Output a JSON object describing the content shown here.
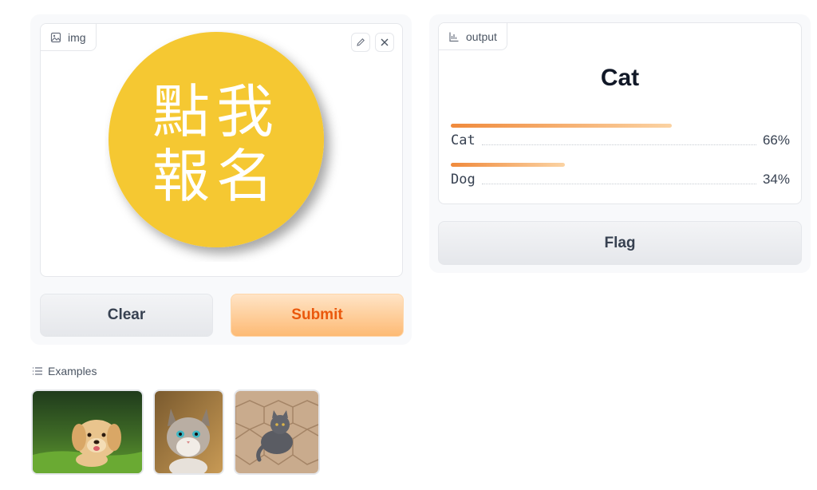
{
  "input": {
    "label": "img",
    "label_icon": "image-icon",
    "edit_icon": "pencil-icon",
    "clear_icon": "close-icon",
    "image_text": {
      "line1": "點我",
      "line2": "報名"
    },
    "badge_color": "#f5c832"
  },
  "buttons": {
    "clear": "Clear",
    "submit": "Submit",
    "flag": "Flag"
  },
  "output": {
    "label": "output",
    "label_icon": "bar-chart-icon",
    "top_label": "Cat",
    "confidences": [
      {
        "label": "Cat",
        "value": 66,
        "display": "66%"
      },
      {
        "label": "Dog",
        "value": 34,
        "display": "34%"
      }
    ]
  },
  "examples": {
    "label": "Examples",
    "label_icon": "list-icon",
    "items": [
      {
        "name": "example-puppy-thumbnail",
        "subject": "puppy on grass"
      },
      {
        "name": "example-kitten-thumbnail",
        "subject": "kitten"
      },
      {
        "name": "example-gray-cat-thumbnail",
        "subject": "gray cat on tiles"
      }
    ]
  },
  "colors": {
    "accent": "#ea580c",
    "bar_start": "#f08a3c",
    "bar_end": "#fbd3a3"
  }
}
